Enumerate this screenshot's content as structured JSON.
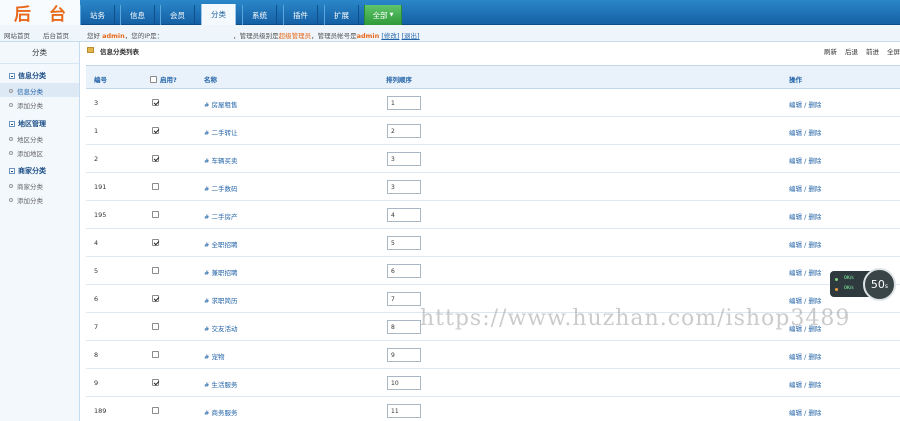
{
  "logo": {
    "char1": "后",
    "char2": "台"
  },
  "nav": {
    "tabs": [
      {
        "label": "站务"
      },
      {
        "label": "信息"
      },
      {
        "label": "会员"
      },
      {
        "label": "分类"
      },
      {
        "label": "系统"
      },
      {
        "label": "插件"
      },
      {
        "label": "扩展"
      }
    ],
    "all_label": "全部",
    "active_index": 3
  },
  "subbar": {
    "home_link": "网站首页",
    "admin_home_link": "后台首页",
    "welcome_prefix": "您好",
    "username": "admin",
    "welcome_mid": "，您的IP是：",
    "ip": "",
    "role_text": "，管理员级别是",
    "role_name": "超级管理员",
    "account_text": "，管理员帐号是",
    "account_name": "admin",
    "edit_link": "[修改]",
    "logout_link": "[退出]"
  },
  "sidebar": {
    "title": "分类",
    "groups": [
      {
        "title": "信息分类",
        "items": [
          {
            "label": "信息分类"
          },
          {
            "label": "添加分类"
          }
        ]
      },
      {
        "title": "地区管理",
        "items": [
          {
            "label": "地区分类"
          },
          {
            "label": "添加地区"
          }
        ]
      },
      {
        "title": "商家分类",
        "items": [
          {
            "label": "商家分类"
          },
          {
            "label": "添加分类"
          }
        ]
      }
    ]
  },
  "main": {
    "panel_title": "信息分类列表",
    "actions": [
      "刷新",
      "后退",
      "前进",
      "全屏"
    ],
    "columns": {
      "id": "编号",
      "enabled": "启用?",
      "name": "名称",
      "sort": "排列顺序",
      "ops": "操作"
    },
    "ops_label": "编辑 / 删除",
    "rows": [
      {
        "id": "3",
        "checked": true,
        "name": "# 房屋租售",
        "sort": "1"
      },
      {
        "id": "1",
        "checked": true,
        "name": "# 二手转让",
        "sort": "2"
      },
      {
        "id": "2",
        "checked": true,
        "name": "# 车辆买卖",
        "sort": "3"
      },
      {
        "id": "191",
        "checked": false,
        "name": "# 二手数码",
        "sort": "3"
      },
      {
        "id": "195",
        "checked": false,
        "name": "# 二手房产",
        "sort": "4"
      },
      {
        "id": "4",
        "checked": true,
        "name": "# 全职招聘",
        "sort": "5"
      },
      {
        "id": "5",
        "checked": false,
        "name": "# 兼职招聘",
        "sort": "6"
      },
      {
        "id": "6",
        "checked": true,
        "name": "# 求职简历",
        "sort": "7"
      },
      {
        "id": "7",
        "checked": false,
        "name": "# 交友活动",
        "sort": "8"
      },
      {
        "id": "8",
        "checked": false,
        "name": "# 宠物",
        "sort": "9"
      },
      {
        "id": "9",
        "checked": true,
        "name": "# 生活服务",
        "sort": "10"
      },
      {
        "id": "189",
        "checked": false,
        "name": "# 商务服务",
        "sort": "11"
      }
    ]
  },
  "timer": {
    "value": "50",
    "unit": "s",
    "up": "0K/s",
    "down": "0K/s"
  },
  "watermark": "https://www.huzhan.com/ishop3489",
  "colors": {
    "nav_blue": "#1f74bb",
    "logo_orange": "#e8681a",
    "link_blue": "#2464a8",
    "all_green": "#3aa844"
  }
}
